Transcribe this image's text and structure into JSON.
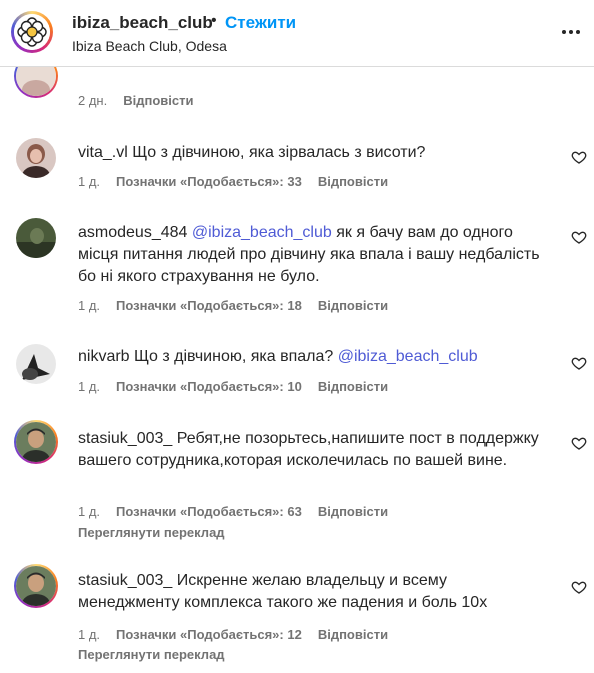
{
  "header": {
    "username": "ibiza_beach_club",
    "separator": "•",
    "follow_label": "Стежити",
    "location": "Ibiza Beach Club, Odesa"
  },
  "partial_comment": {
    "time": "2 дн.",
    "reply_label": "Відповісти"
  },
  "comments": [
    {
      "username": "vita_.vl",
      "text": "Що з дівчиною, яка зірвалась з висоти?",
      "time": "1 д.",
      "likes": "Позначки «Подобається»: 33",
      "reply_label": "Відповісти"
    },
    {
      "username": "asmodeus_484",
      "mention": "@ibiza_beach_club",
      "text": "як я бачу вам до одного місця питання людей про дівчину яка впала і вашу недбалість бо ні якого страхування не було.",
      "time": "1 д.",
      "likes": "Позначки «Подобається»: 18",
      "reply_label": "Відповісти"
    },
    {
      "username": "nikvarb",
      "text": "Що з дівчиною, яка впала?",
      "mention": "@ibiza_beach_club",
      "time": "1 д.",
      "likes": "Позначки «Подобається»: 10",
      "reply_label": "Відповісти"
    },
    {
      "username": "stasiuk_003_",
      "text": "Ребят,не позорьтесь,напишите пост в поддержку вашего сотрудника,которая исколечилась по вашей вине.",
      "time": "1 д.",
      "likes": "Позначки «Подобається»: 63",
      "reply_label": "Відповісти",
      "translate_label": "Переглянути переклад"
    },
    {
      "username": "stasiuk_003_",
      "text": "Искренне желаю владельцу и всему менеджменту комплекса такого же падения и боль 10х",
      "time": "1 д.",
      "likes": "Позначки «Подобається»: 12",
      "reply_label": "Відповісти",
      "translate_label": "Переглянути переклад"
    }
  ],
  "icons": {
    "more": "more-horizontal-icon",
    "like": "heart-outline-icon",
    "logo": "flower-logo"
  },
  "colors": {
    "link_blue": "#0095f6",
    "mention": "#4f5bd5",
    "meta_gray": "#737373"
  }
}
